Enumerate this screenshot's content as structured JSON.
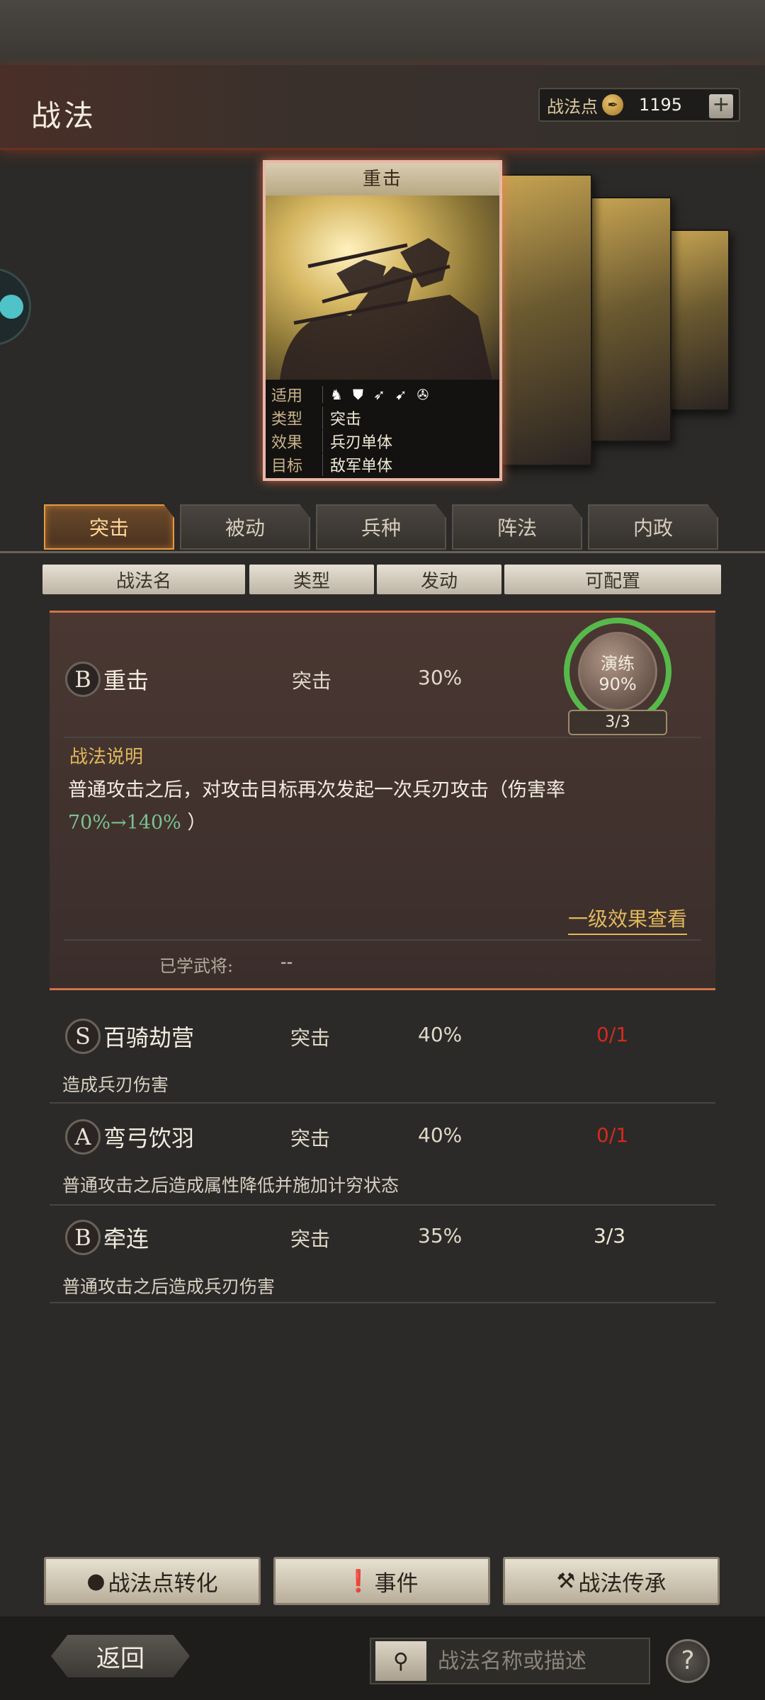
{
  "header": {
    "title": "战法",
    "points_label": "战法点",
    "points_value": "1195",
    "plus_label": "+"
  },
  "card": {
    "title": "重击",
    "rows": [
      {
        "key": "适用",
        "troop_icons": [
          "cavalry-icon",
          "shield-icon",
          "bow-icon",
          "spear-icon",
          "chariot-icon"
        ]
      },
      {
        "key": "类型",
        "value": "突击"
      },
      {
        "key": "效果",
        "value": "兵刃单体"
      },
      {
        "key": "目标",
        "value": "敌军单体"
      }
    ]
  },
  "tabs": [
    "突击",
    "被动",
    "兵种",
    "阵法",
    "内政"
  ],
  "columns": [
    "战法名",
    "类型",
    "发动",
    "可配置"
  ],
  "expanded": {
    "grade": "B",
    "name": "重击",
    "type": "突击",
    "rate": "30%",
    "ring_label": "演练",
    "ring_percent": "90%",
    "ring_count": "3/3",
    "desc_title": "战法说明",
    "desc_text": "普通攻击之后，对攻击目标再次发起一次兵刃攻击（伤害率",
    "desc_rate": "70%→140%",
    "desc_end": "）",
    "level_link": "一级效果查看",
    "learned_label": "已学武将:",
    "learned_value": "--"
  },
  "skills": [
    {
      "grade": "S",
      "name": "百骑劫营",
      "type": "突击",
      "rate": "40%",
      "count": "0/1",
      "count_color": "#d22a1e",
      "desc": "造成兵刃伤害"
    },
    {
      "grade": "A",
      "name": "弯弓饮羽",
      "type": "突击",
      "rate": "40%",
      "count": "0/1",
      "count_color": "#d22a1e",
      "desc": "普通攻击之后造成属性降低并施加计穷状态"
    },
    {
      "grade": "B",
      "name": "牵连",
      "type": "突击",
      "rate": "35%",
      "count": "3/3",
      "count_color": "#f0ead8",
      "desc": "普通攻击之后造成兵刃伤害"
    }
  ],
  "buttons": {
    "convert": "战法点转化",
    "event": "事件",
    "inherit": "战法传承"
  },
  "footer": {
    "back": "返回",
    "search_placeholder": "战法名称或描述",
    "help": "?"
  }
}
